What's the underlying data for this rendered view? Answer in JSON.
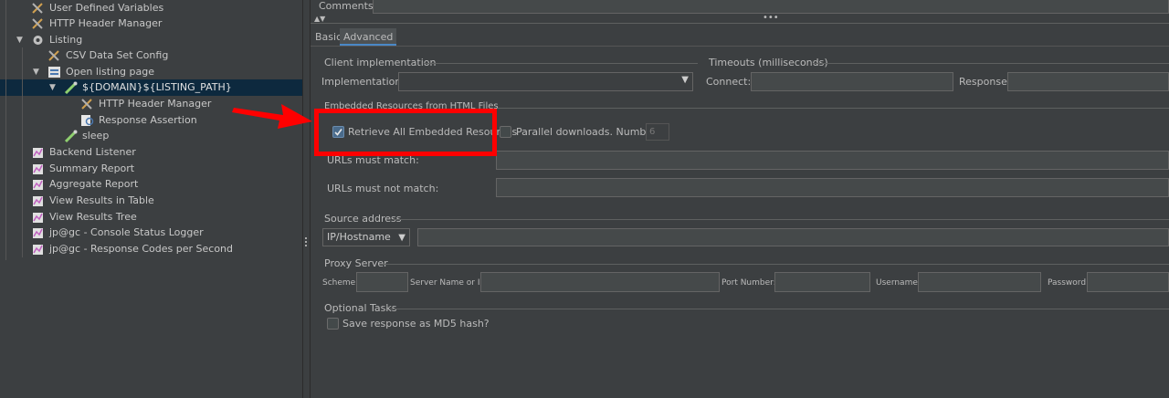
{
  "tree": {
    "items": [
      {
        "label": "User Defined Variables",
        "icon": "tools-icon"
      },
      {
        "label": "HTTP Header Manager",
        "icon": "tools-icon"
      },
      {
        "label": "Listing",
        "icon": "gear-icon"
      },
      {
        "label": "CSV Data Set Config",
        "icon": "tools-icon"
      },
      {
        "label": "Open listing page",
        "icon": "controller-icon"
      },
      {
        "label": "${DOMAIN}${LISTING_PATH}",
        "icon": "sampler-pipette-icon"
      },
      {
        "label": "HTTP Header Manager",
        "icon": "tools-icon"
      },
      {
        "label": "Response Assertion",
        "icon": "assertion-icon"
      },
      {
        "label": "sleep",
        "icon": "sampler-pipette-icon"
      },
      {
        "label": "Backend Listener",
        "icon": "listener-icon"
      },
      {
        "label": "Summary Report",
        "icon": "listener-icon"
      },
      {
        "label": "Aggregate Report",
        "icon": "listener-icon"
      },
      {
        "label": "View Results in Table",
        "icon": "listener-icon"
      },
      {
        "label": "View Results Tree",
        "icon": "listener-icon"
      },
      {
        "label": "jp@gc - Console Status Logger",
        "icon": "listener-icon"
      },
      {
        "label": "jp@gc - Response Codes per Second",
        "icon": "listener-icon"
      }
    ]
  },
  "comments": {
    "label": "Comments:",
    "value": ""
  },
  "tabs": [
    {
      "label": "Basic"
    },
    {
      "label": "Advanced"
    }
  ],
  "client": {
    "section_title": "Client implementation",
    "implementation_label": "Implementation:",
    "implementation_value": ""
  },
  "timeouts": {
    "section_title": "Timeouts (milliseconds)",
    "connect_label": "Connect:",
    "connect_value": "",
    "response_label": "Response:",
    "response_value": ""
  },
  "embedded": {
    "section_title": "Embedded Resources from HTML Files",
    "retrieve_label": "Retrieve All Embedded Resources",
    "retrieve_checked": true,
    "parallel_label": "Parallel downloads. Number:",
    "parallel_checked": false,
    "parallel_number": "6",
    "urls_match_label": "URLs must match:",
    "urls_match_value": "",
    "urls_not_match_label": "URLs must not match:",
    "urls_not_match_value": ""
  },
  "source": {
    "section_title": "Source address",
    "type_value": "IP/Hostname",
    "address_value": ""
  },
  "proxy": {
    "section_title": "Proxy Server",
    "scheme_label": "Scheme:",
    "server_label": "Server Name or IP:",
    "port_label": "Port Number:",
    "username_label": "Username:",
    "password_label": "Password:"
  },
  "optional": {
    "section_title": "Optional Tasks",
    "md5_label": "Save response as MD5 hash?",
    "md5_checked": false
  },
  "colors": {
    "highlight": "#ff0000",
    "arrow": "#ff0000",
    "selection": "#0d293e"
  }
}
